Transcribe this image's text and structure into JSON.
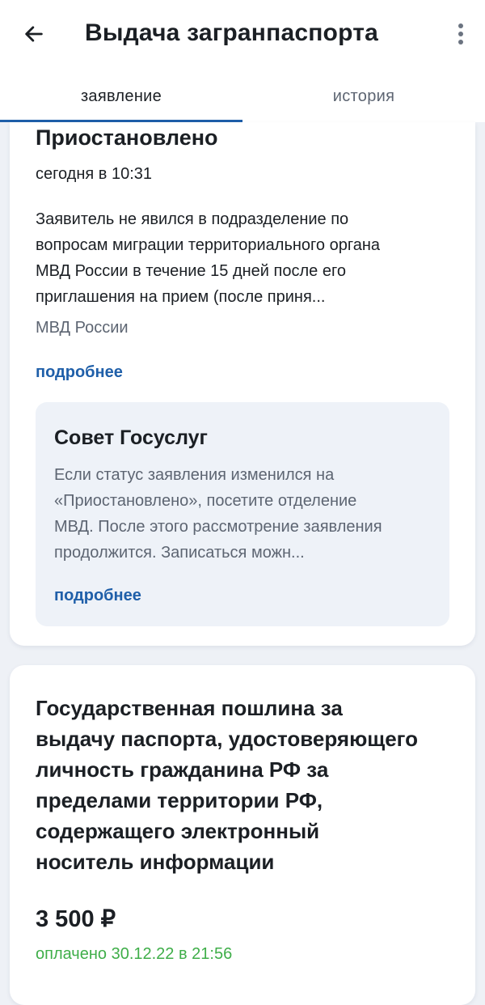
{
  "header": {
    "title": "Выдача загранпаспорта",
    "back_icon": "arrow-left-icon",
    "menu_icon": "more-vertical-icon"
  },
  "tabs": [
    {
      "label": "заявление",
      "active": true
    },
    {
      "label": "история",
      "active": false
    }
  ],
  "status": {
    "title": "Приостановлено",
    "time": "сегодня в 10:31",
    "description_lines": [
      "Заявитель не явился в подразделение по",
      "вопросам миграции территориального органа",
      "МВД России в течение 15 дней после его",
      "приглашения на прием (после приня..."
    ],
    "organization": "МВД России",
    "more_label": "подробнее"
  },
  "advice": {
    "title": "Совет Госуслуг",
    "text_lines": [
      "Если статус заявления изменился на",
      "«Приостановлено», посетите отделение",
      "МВД. После этого рассмотрение заявления",
      "продолжится. Записаться можн..."
    ],
    "more_label": "подробнее"
  },
  "fee": {
    "title_lines": [
      "Государственная пошлина за",
      "выдачу паспорта, удостоверяющего",
      "личность гражданина РФ за",
      "пределами территории РФ,",
      "содержащего электронный",
      "носитель информации"
    ],
    "amount": "3 500 ₽",
    "paid_status": "оплачено 30.12.22 в 21:56"
  },
  "colors": {
    "accent": "#1f5fa9",
    "success": "#3fae49",
    "secondary_text": "#5d6572",
    "advice_background": "#eef2f8"
  }
}
